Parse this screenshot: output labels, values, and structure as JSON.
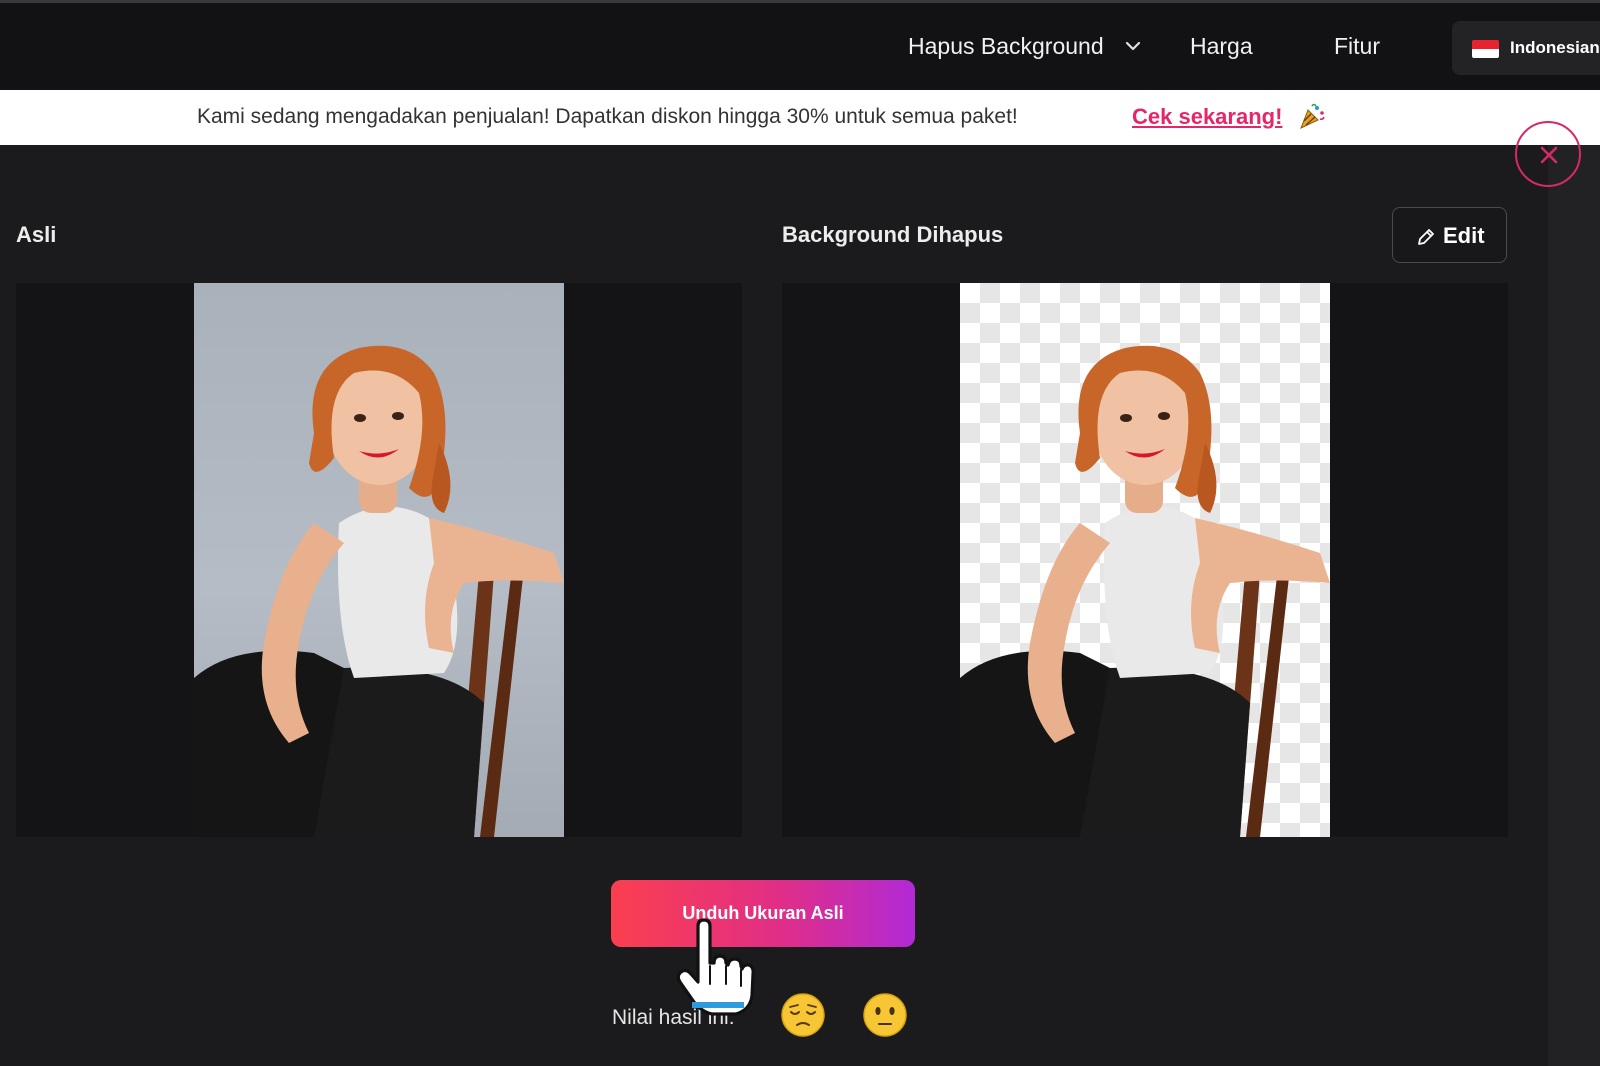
{
  "nav": {
    "remove_bg": "Hapus Background",
    "pricing": "Harga",
    "features": "Fitur",
    "language": "Indonesian"
  },
  "promo": {
    "text": "Kami sedang mengadakan penjualan! Dapatkan diskon hingga 30% untuk semua paket!",
    "link": "Cek sekarang!"
  },
  "panels": {
    "original_title": "Asli",
    "removed_title": "Background Dihapus",
    "edit_label": "Edit"
  },
  "download": {
    "label": "Unduh Ukuran Asli"
  },
  "rating": {
    "label": "Nilai hasil ini:"
  },
  "colors": {
    "accent_pink": "#e6266b",
    "gradient_start": "#fb3f4f",
    "gradient_end": "#b12ad6",
    "background": "#1b1b1d"
  },
  "icons": [
    "chevron-down-icon",
    "flag-indonesia-icon",
    "party-popper-icon",
    "close-icon",
    "pencil-icon",
    "sleepy-face-emoji",
    "no-mouth-face-emoji",
    "hand-pointer-cursor"
  ]
}
